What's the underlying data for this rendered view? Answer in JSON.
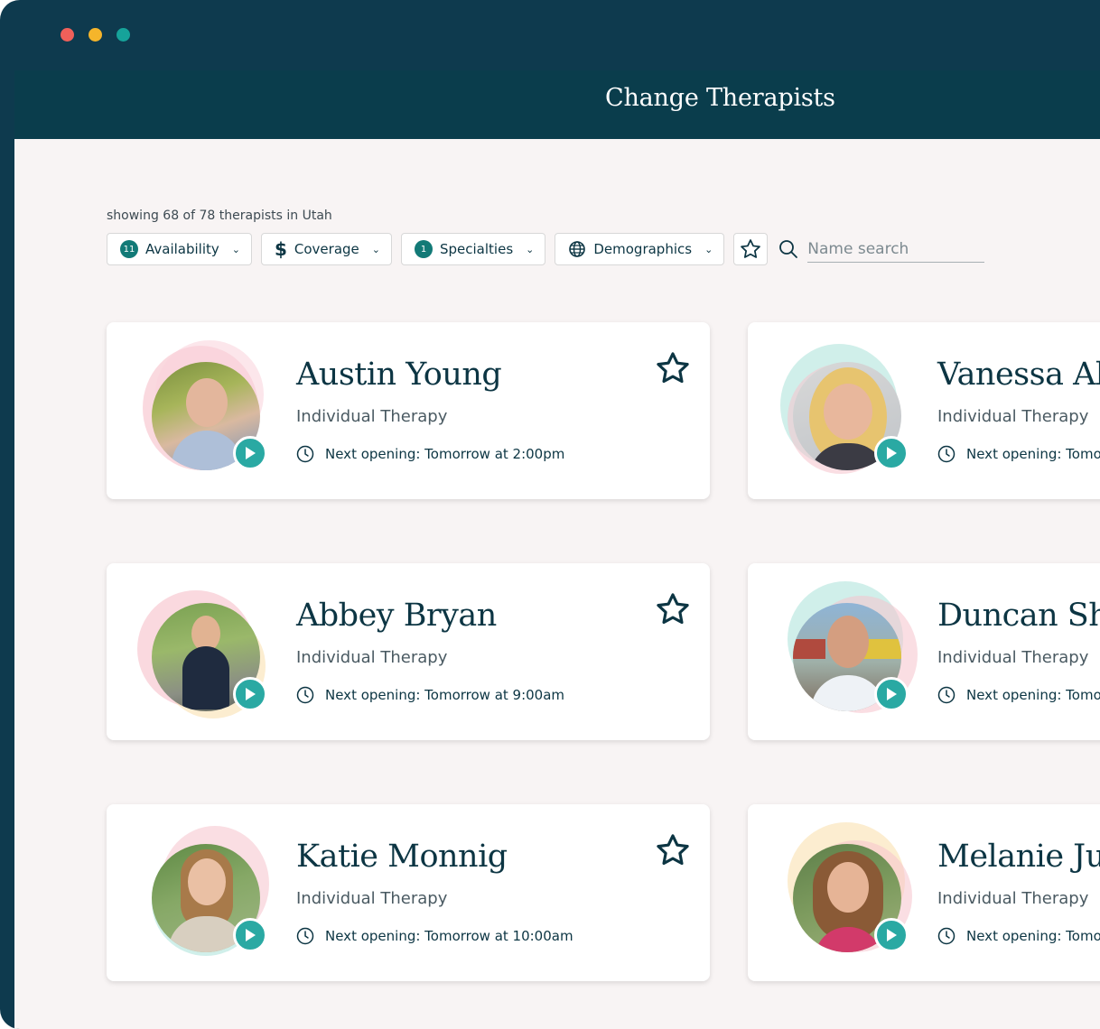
{
  "window": {
    "title": "Change Therapists"
  },
  "results": {
    "summary": "showing 68 of 78 therapists in Utah"
  },
  "filters": [
    {
      "label": "Availability",
      "badge": "11",
      "icon": "count-badge"
    },
    {
      "label": "Coverage",
      "badge": "",
      "icon": "dollar-icon"
    },
    {
      "label": "Specialties",
      "badge": "1",
      "icon": "count-badge"
    },
    {
      "label": "Demographics",
      "badge": "",
      "icon": "globe-icon"
    }
  ],
  "search": {
    "placeholder": "Name search"
  },
  "colors": {
    "header": "#0a3d4c",
    "accent": "#2aa9a3",
    "text": "#0c3543"
  },
  "therapists": [
    {
      "name": "Austin Young",
      "type": "Individual Therapy",
      "opening": "Next opening: Tomorrow at 2:00pm"
    },
    {
      "name": "Vanessa Al",
      "type": "Individual Therapy",
      "opening": "Next opening: Tomor"
    },
    {
      "name": "Abbey Bryan",
      "type": "Individual Therapy",
      "opening": "Next opening: Tomorrow at 9:00am"
    },
    {
      "name": "Duncan Sh",
      "type": "Individual Therapy",
      "opening": "Next opening: Tomor"
    },
    {
      "name": "Katie Monnig",
      "type": "Individual Therapy",
      "opening": "Next opening: Tomorrow at 10:00am"
    },
    {
      "name": "Melanie Ju",
      "type": "Individual Therapy",
      "opening": "Next opening: Tomor"
    }
  ]
}
